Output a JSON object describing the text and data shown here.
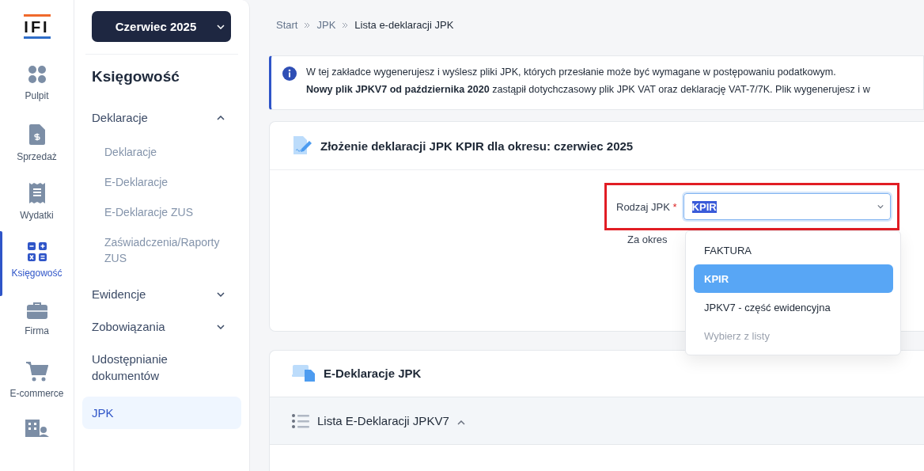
{
  "logo": "IFI",
  "rail": {
    "items": [
      {
        "kind": "dots",
        "label": "Pulpit",
        "selected": false
      },
      {
        "kind": "invoice",
        "label": "Sprzedaż",
        "selected": false
      },
      {
        "kind": "receipt",
        "label": "Wydatki",
        "selected": false
      },
      {
        "kind": "calculator",
        "label": "Księgowość",
        "selected": true
      },
      {
        "kind": "briefcase",
        "label": "Firma",
        "selected": false
      },
      {
        "kind": "cart",
        "label": "E-commerce",
        "selected": false
      },
      {
        "kind": "building",
        "selected": false
      }
    ]
  },
  "sidebar": {
    "period_button": "Czerwiec 2025",
    "title": "Księgowość",
    "items": [
      {
        "label": "Deklaracje",
        "expanded": true,
        "selected": false,
        "children": [
          {
            "label": "Deklaracje",
            "selected": false
          },
          {
            "label": "E-Deklaracje",
            "selected": false
          },
          {
            "label": "E-Deklaracje ZUS",
            "selected": false
          },
          {
            "label": "Zaświadczenia/Raporty ZUS",
            "selected": false
          }
        ]
      },
      {
        "label": "Ewidencje",
        "expanded": false,
        "selected": false
      },
      {
        "label": "Zobowiązania",
        "expanded": false,
        "selected": false
      },
      {
        "label": "Udostępnianie dokumentów",
        "selected": false
      },
      {
        "label": "JPK",
        "selected": true
      }
    ]
  },
  "breadcrumb": [
    "Start",
    "JPK",
    "Lista e-deklaracji JPK"
  ],
  "info": {
    "lines": [
      "W tej zakładce wygenerujesz i wyślesz pliki JPK, których przesłanie może być wymagane w postępowaniu podatkowym.",
      "**Nowy plik JPKV7 od października 2020** zastąpił dotychczasowy plik JPK VAT oraz deklarację VAT-7/7K. Plik wygenerujesz i w"
    ]
  },
  "declaration_card": {
    "title": "Złożenie deklaracji JPK KPIR dla okresu: czerwiec 2025",
    "field": {
      "label": "Rodzaj JPK",
      "required_mark": "*",
      "value": "KPIR",
      "value_selected": true,
      "highlighted": true
    },
    "period_label": "Za okres",
    "dropdown": {
      "options": [
        {
          "label": "FAKTURA",
          "selected": false,
          "disabled": false
        },
        {
          "label": "KPIR",
          "selected": true,
          "disabled": false
        },
        {
          "label": "JPKV7 - część ewidencyjna",
          "selected": false,
          "disabled": false
        },
        {
          "label": "Wybierz z listy",
          "selected": false,
          "disabled": true
        }
      ]
    }
  },
  "edeclarations_card": {
    "title": "E-Deklaracje JPK",
    "list_section": {
      "title": "Lista E-Deklaracji JPKV7",
      "expanded": true
    }
  }
}
